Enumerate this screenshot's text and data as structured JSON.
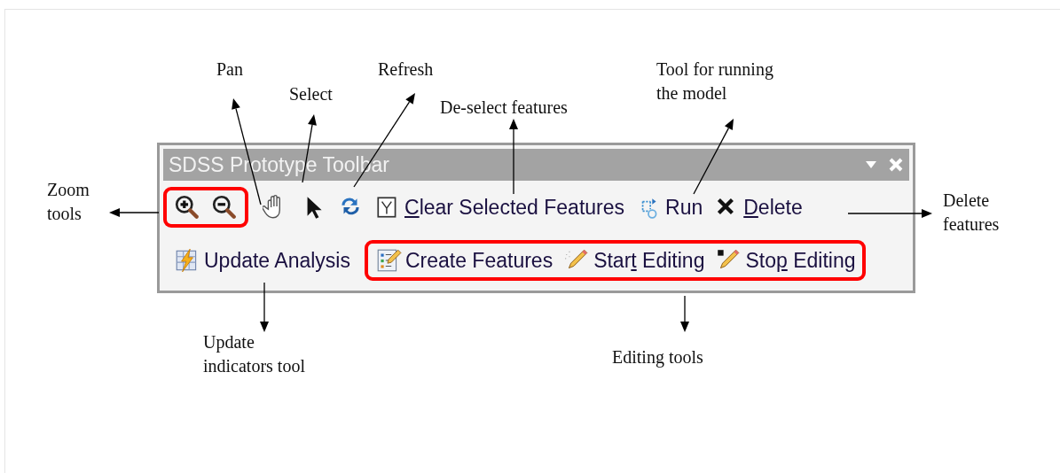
{
  "toolbar": {
    "title": "SDSS Prototype Toolbar",
    "rows": [
      {
        "groups": [
          {
            "highlighted": true,
            "items": [
              {
                "kind": "zoom-in"
              },
              {
                "kind": "zoom-out"
              }
            ]
          },
          {
            "highlighted": false,
            "items": [
              {
                "kind": "pan"
              },
              {
                "kind": "select"
              },
              {
                "kind": "refresh"
              },
              {
                "kind": "clear",
                "label_parts": [
                  {
                    "text": "C",
                    "underlined": true
                  },
                  {
                    "text": "lear Selected Features",
                    "underlined": false
                  }
                ]
              },
              {
                "kind": "run",
                "label_parts": [
                  {
                    "text": "Run",
                    "underlined": false
                  }
                ]
              },
              {
                "kind": "delete",
                "label_parts": [
                  {
                    "text": "D",
                    "underlined": true
                  },
                  {
                    "text": "elete",
                    "underlined": false
                  }
                ]
              }
            ]
          }
        ]
      },
      {
        "groups": [
          {
            "highlighted": false,
            "items": [
              {
                "kind": "update",
                "label_parts": [
                  {
                    "text": "Update Analysis",
                    "underlined": false
                  }
                ]
              }
            ]
          },
          {
            "highlighted": true,
            "items": [
              {
                "kind": "create",
                "label_parts": [
                  {
                    "text": "Create Features",
                    "underlined": false
                  }
                ]
              },
              {
                "kind": "start-edit",
                "label_parts": [
                  {
                    "text": "Star",
                    "underlined": false
                  },
                  {
                    "text": "t",
                    "underlined": true
                  },
                  {
                    "text": " Editing",
                    "underlined": false
                  }
                ]
              },
              {
                "kind": "stop-edit",
                "label_parts": [
                  {
                    "text": "Sto",
                    "underlined": false
                  },
                  {
                    "text": "p",
                    "underlined": true
                  },
                  {
                    "text": " Editing",
                    "underlined": false
                  }
                ]
              }
            ]
          }
        ]
      }
    ]
  },
  "annotations": [
    {
      "lines": [
        "Pan"
      ]
    },
    {
      "lines": [
        "Select"
      ]
    },
    {
      "lines": [
        "Refresh"
      ]
    },
    {
      "lines": [
        "De-select features"
      ]
    },
    {
      "lines": [
        "Tool for running",
        "the model"
      ]
    },
    {
      "lines": [
        "Zoom",
        "tools"
      ]
    },
    {
      "lines": [
        "Delete",
        "features"
      ]
    },
    {
      "lines": [
        "Update",
        "indicators tool"
      ]
    },
    {
      "lines": [
        "Editing tools"
      ]
    }
  ]
}
